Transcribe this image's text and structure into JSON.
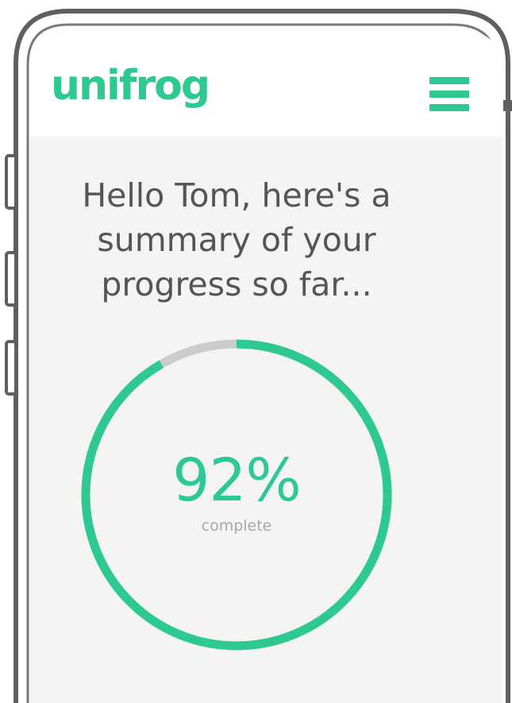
{
  "app": {
    "logo_text": "unifrog",
    "menu_icon": "hamburger-menu-icon"
  },
  "greeting": {
    "line1": "Hello Tom, here's a",
    "line2": "summary of your",
    "line3": "progress so far..."
  },
  "progress": {
    "value": 92,
    "label": "92%",
    "caption": "complete"
  },
  "colors": {
    "brand": "#2ec990",
    "track": "#cccccc",
    "background": "#f4f4f4",
    "frame": "#555555"
  }
}
